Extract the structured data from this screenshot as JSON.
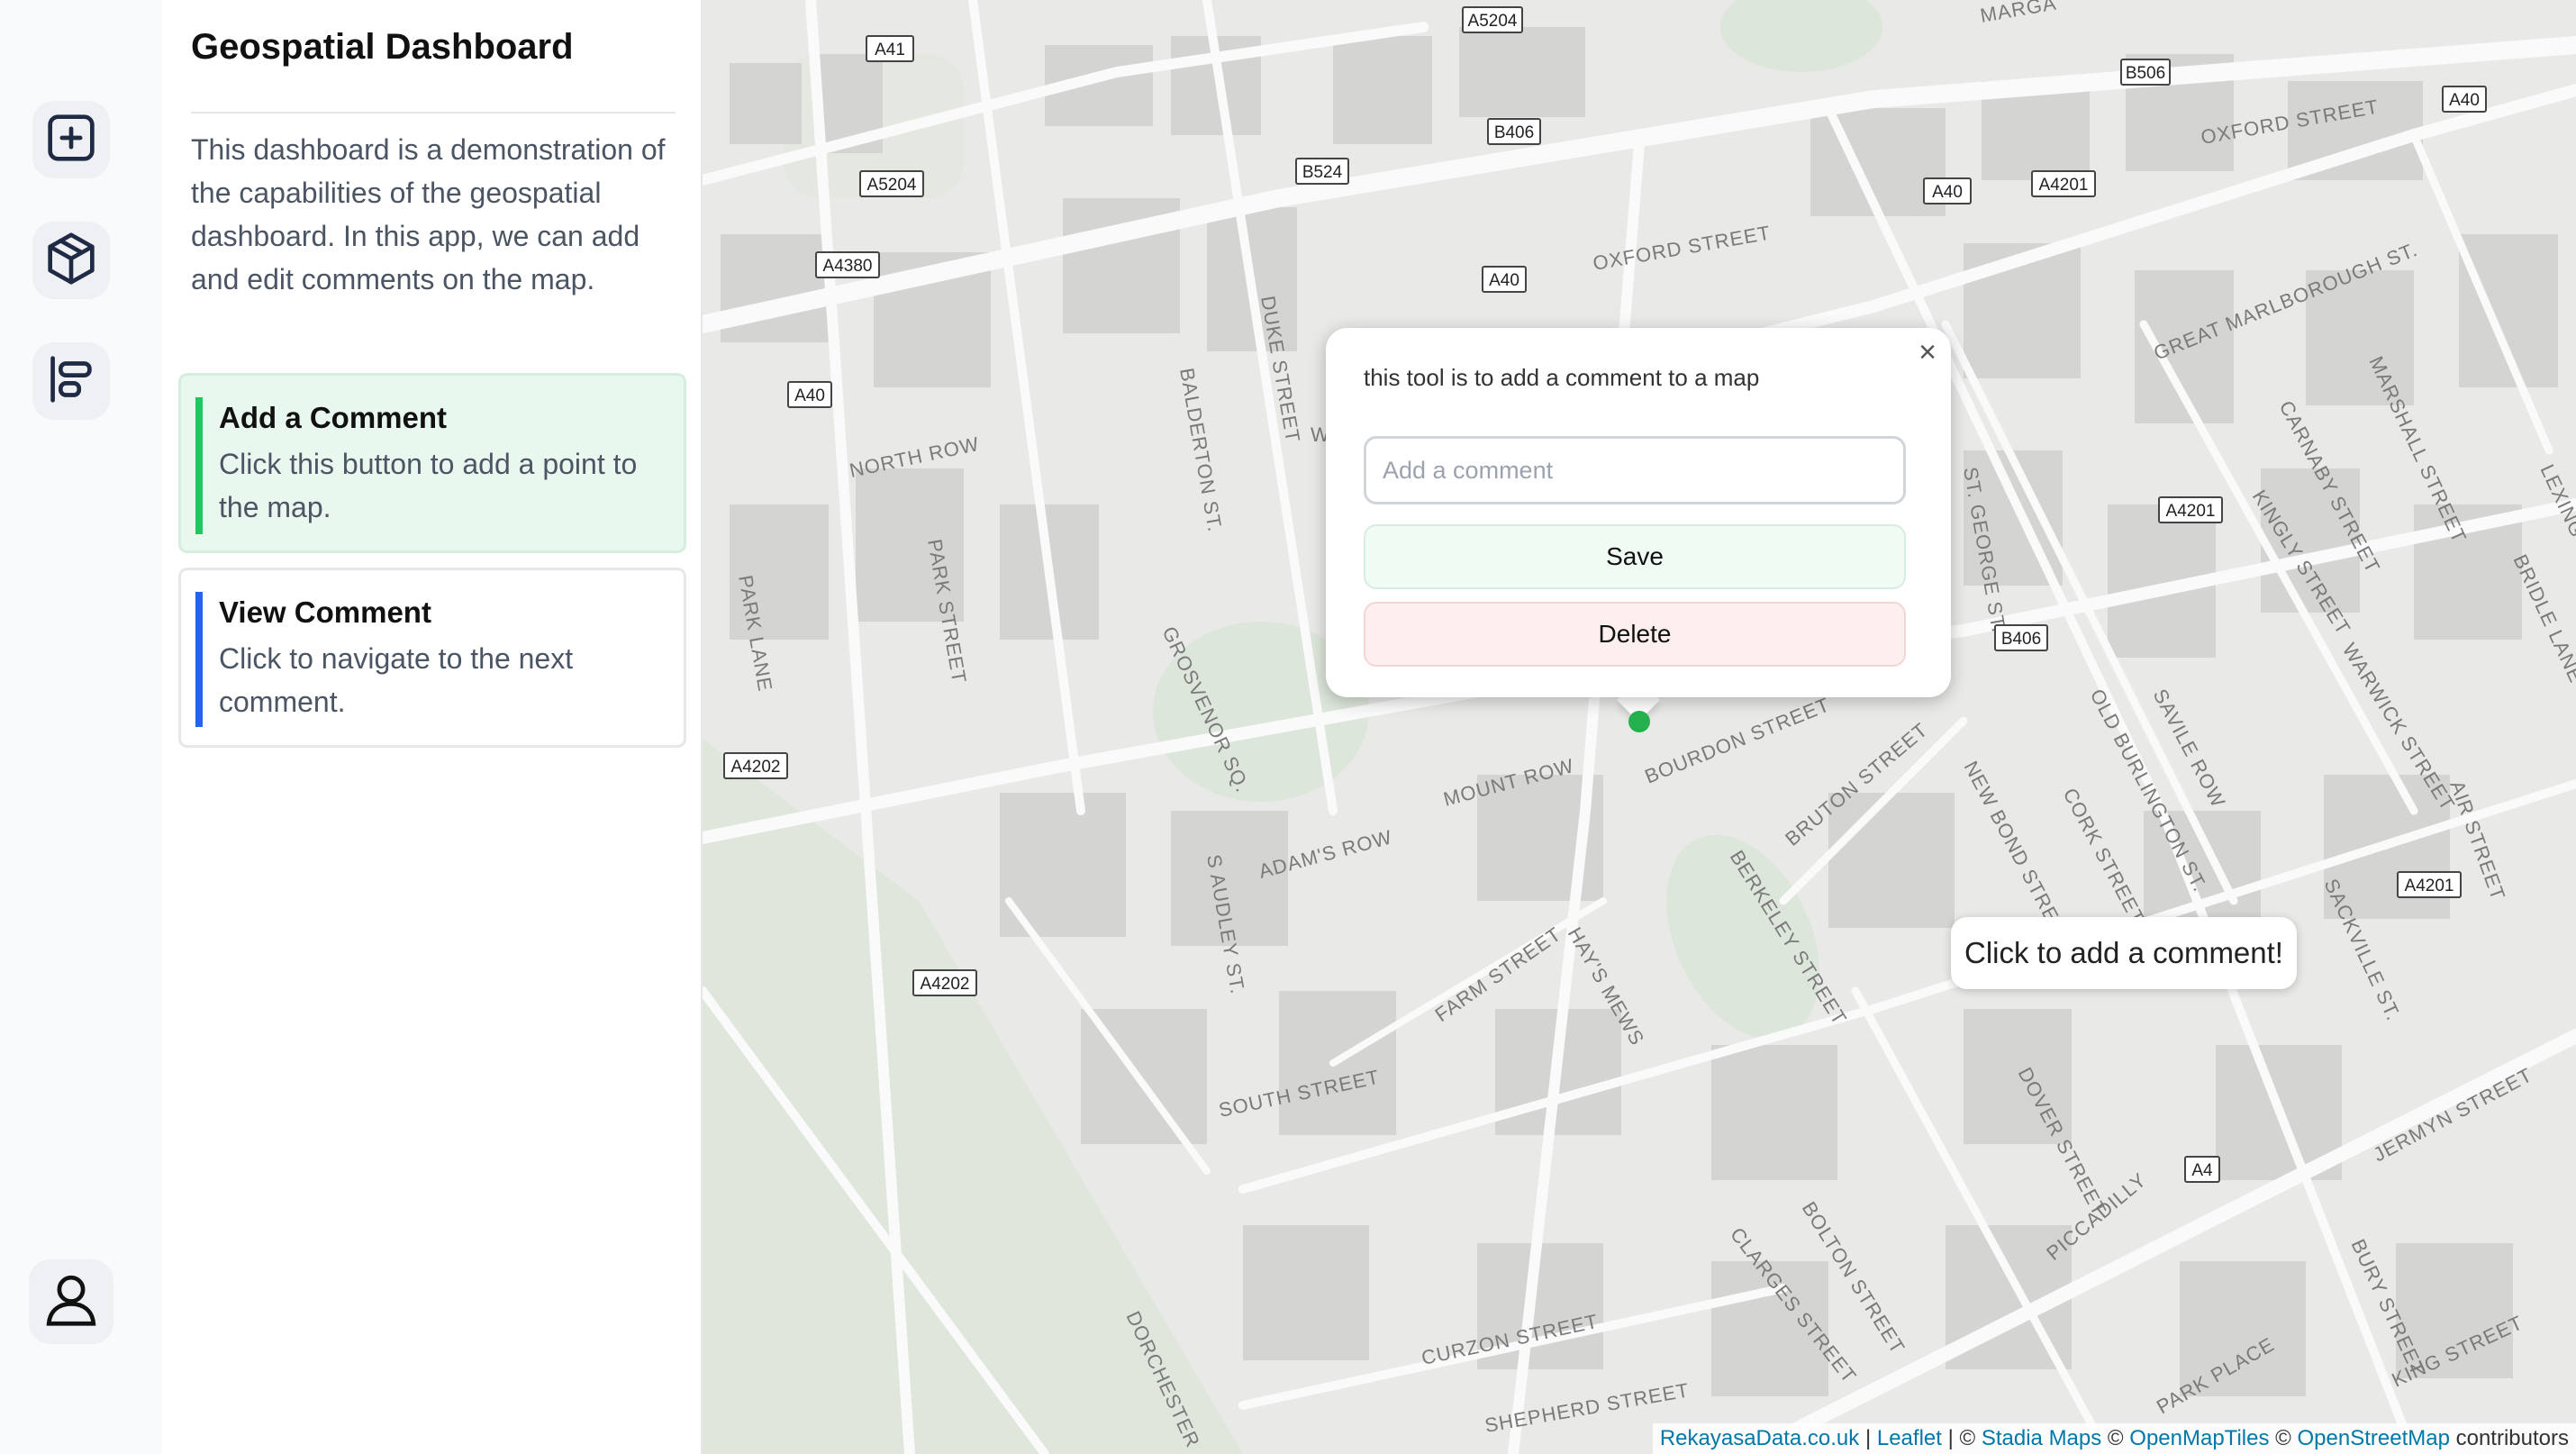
{
  "sidebar": {
    "icons": [
      {
        "name": "add-square-icon"
      },
      {
        "name": "box-3d-icon"
      },
      {
        "name": "align-left-icon"
      }
    ],
    "profile_icon": "user-icon"
  },
  "panel": {
    "title": "Geospatial Dashboard",
    "description": "This dashboard is a demonstration of the capabilities of the geospatial dashboard. In this app, we can add and edit comments on the map.",
    "cards": [
      {
        "title": "Add a Comment",
        "text": "Click this button to add a point to the map.",
        "accent": "#22c55e"
      },
      {
        "title": "View Comment",
        "text": "Click to navigate to the next comment.",
        "accent": "#2563eb"
      }
    ]
  },
  "map": {
    "streets": [
      "OXFORD STREET",
      "OXFORD STREET",
      "GREAT MARLBOROUGH ST.",
      "NORTH ROW",
      "PARK STREET",
      "PARK LANE",
      "GROSVENOR SQ.",
      "DUKE STREET",
      "BALDERTON ST.",
      "MOUNT ROW",
      "BOURDON STREET",
      "BRUTON STREET",
      "BERKELEY STREET",
      "NEW BOND STREET",
      "CORK STREET",
      "OLD BURLINGTON ST.",
      "SAVILE ROW",
      "ADAM'S ROW",
      "S AUDLEY ST.",
      "FARM STREET",
      "HAY'S MEWS",
      "SOUTH STREET",
      "CARNABY STREET",
      "MARSHALL STREET",
      "KINGLY STREET",
      "WARWICK STREET",
      "SACKVILLE ST.",
      "AIR STREET",
      "DOVER STREET",
      "PICCADILLY",
      "JERMYN STREET",
      "BOLTON STREET",
      "CLARGES STREET",
      "CURZON STREET",
      "SHEPHERD STREET",
      "PARK PLACE",
      "KING STREET",
      "BURY STREET",
      "DORCHESTER",
      "BRIDLE LANE",
      "LEXING",
      "MARGA",
      "ST. GEORGE ST.",
      "W"
    ],
    "shields": [
      "A41",
      "A5204",
      "B506",
      "A40",
      "B406",
      "B524",
      "A40",
      "A4201",
      "A5204",
      "A4380",
      "A40",
      "A40",
      "A4201",
      "B406",
      "A4202",
      "A4201",
      "A4202",
      "A4"
    ],
    "popup": {
      "text": "this tool is to add a comment to a map",
      "input_placeholder": "Add a comment",
      "input_value": "",
      "save_label": "Save",
      "delete_label": "Delete",
      "close_label": "×"
    },
    "tooltip": "Click to add a comment!",
    "marker_color": "#22b14c",
    "attribution": {
      "link1": "RekayasaData.co.uk",
      "sep1": " | ",
      "link2": "Leaflet",
      "sep2": " | © ",
      "link3": "Stadia Maps",
      "sep3": " © ",
      "link4": "OpenMapTiles",
      "sep4": " © ",
      "link5": "OpenStreetMap",
      "suffix": " contributors"
    }
  }
}
